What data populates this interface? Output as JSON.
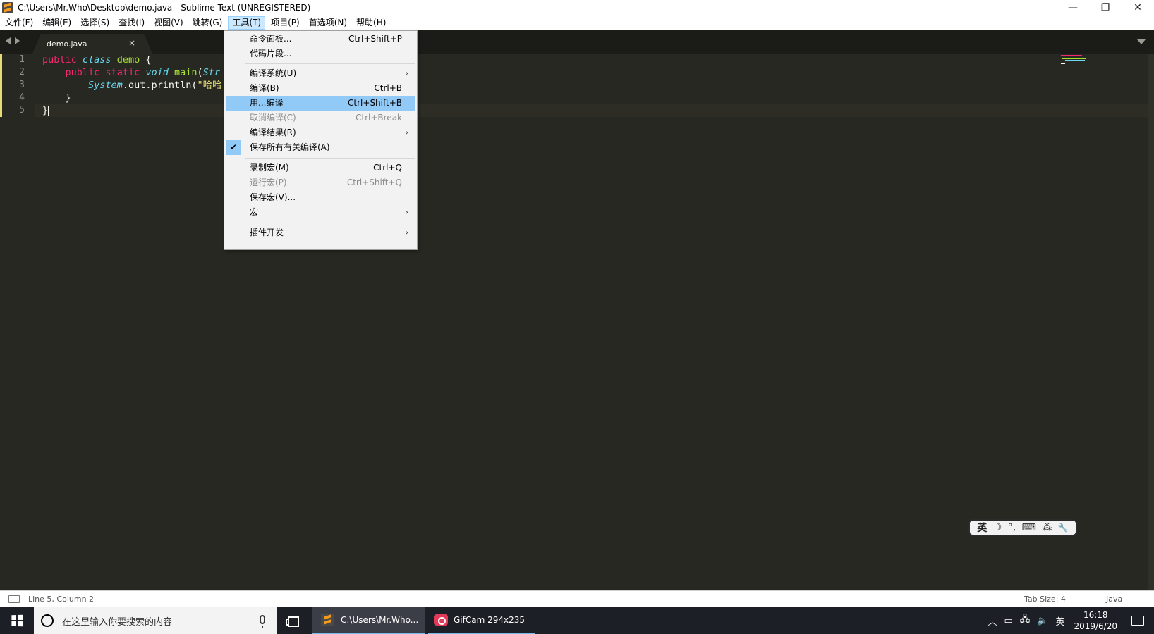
{
  "window": {
    "title": "C:\\Users\\Mr.Who\\Desktop\\demo.java - Sublime Text (UNREGISTERED)",
    "minimize": "—",
    "maximize": "❐",
    "close": "✕"
  },
  "menubar": {
    "items": [
      "文件(F)",
      "编辑(E)",
      "选择(S)",
      "查找(I)",
      "视图(V)",
      "跳转(G)",
      "工具(T)",
      "项目(P)",
      "首选项(N)",
      "帮助(H)"
    ],
    "active_index": 6
  },
  "tab": {
    "label": "demo.java",
    "close": "×"
  },
  "editor": {
    "line_numbers": [
      "1",
      "2",
      "3",
      "4",
      "5"
    ],
    "lines": [
      [
        "public",
        " ",
        "class",
        " ",
        "demo",
        " {"
      ],
      [
        "    ",
        "public",
        " ",
        "static",
        " ",
        "void",
        " ",
        "main",
        "(",
        "Str"
      ],
      [
        "        ",
        "System",
        ".out.println(",
        "\"哈哈"
      ],
      [
        "    }"
      ],
      [
        "}"
      ]
    ]
  },
  "tools_menu": {
    "items": [
      {
        "label": "命令面板...",
        "shortcut": "Ctrl+Shift+P",
        "submenu": false,
        "disabled": false
      },
      {
        "label": "代码片段...",
        "shortcut": "",
        "submenu": false,
        "disabled": false
      },
      {
        "separator": true
      },
      {
        "label": "编译系统(U)",
        "shortcut": "",
        "submenu": true,
        "disabled": false
      },
      {
        "label": "编译(B)",
        "shortcut": "Ctrl+B",
        "submenu": false,
        "disabled": false
      },
      {
        "label": "用...编译",
        "shortcut": "Ctrl+Shift+B",
        "submenu": false,
        "disabled": false,
        "highlighted": true
      },
      {
        "label": "取消编译(C)",
        "shortcut": "Ctrl+Break",
        "submenu": false,
        "disabled": true
      },
      {
        "label": "编译结果(R)",
        "shortcut": "",
        "submenu": true,
        "disabled": false
      },
      {
        "label": "保存所有有关编译(A)",
        "shortcut": "",
        "submenu": false,
        "disabled": false,
        "checked": true
      },
      {
        "separator": true
      },
      {
        "label": "录制宏(M)",
        "shortcut": "Ctrl+Q",
        "submenu": false,
        "disabled": false
      },
      {
        "label": "运行宏(P)",
        "shortcut": "Ctrl+Shift+Q",
        "submenu": false,
        "disabled": true
      },
      {
        "label": "保存宏(V)...",
        "shortcut": "",
        "submenu": false,
        "disabled": false
      },
      {
        "label": "宏",
        "shortcut": "",
        "submenu": true,
        "disabled": false
      },
      {
        "separator": true
      },
      {
        "label": "插件开发",
        "shortcut": "",
        "submenu": true,
        "disabled": false
      }
    ]
  },
  "statusbar": {
    "position": "Line 5, Column 2",
    "tab_size": "Tab Size: 4",
    "syntax": "Java"
  },
  "ime": {
    "items": [
      "英",
      "☽",
      "°,",
      "⌨",
      "⁂",
      "🔧"
    ]
  },
  "taskbar": {
    "search_placeholder": "在这里输入你要搜索的内容",
    "apps": [
      {
        "label": "C:\\Users\\Mr.Who..."
      },
      {
        "label": "GifCam 294x235"
      }
    ],
    "tray": {
      "lang": "英",
      "time": "16:18",
      "date": "2019/6/20"
    }
  },
  "colors": {
    "editor_bg": "#272822",
    "keyword": "#f92672",
    "storage": "#66d9ef",
    "entity": "#a6e22e",
    "string": "#e6db74",
    "menu_highlight": "#91c9f7"
  }
}
